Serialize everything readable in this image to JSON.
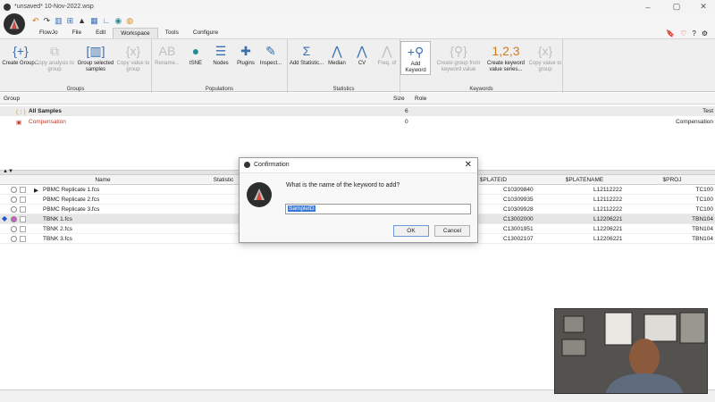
{
  "window": {
    "title": "*unsaved* 10-Nov-2022.wsp"
  },
  "menu": [
    "FlowJo",
    "File",
    "Edit",
    "Workspace",
    "Tools",
    "Configure"
  ],
  "menu_active": "Workspace",
  "ribbon": {
    "groups": {
      "groups_label": "Groups",
      "create_group": "Create Group...",
      "copy_analysis": "Copy analysis to group",
      "group_selected": "Group selected samples",
      "copy_value_group": "Copy value to group",
      "populations_label": "Populations",
      "rename": "Rename...",
      "tsne": "tSNE",
      "nodes": "Nodes",
      "plugins": "Plugins",
      "inspect": "Inspect...",
      "statistics_label": "Statistics",
      "add_statistic": "Add Statistic...",
      "median": "Median",
      "cv": "CV",
      "freq_of": "Freq. of",
      "keywords_label": "Keywords",
      "add_keyword": "Add Keyword",
      "create_group_kw": "Create group from keyword value",
      "create_kw_series": "Create keyword value series...",
      "copy_value_kw": "Copy value to group"
    }
  },
  "group_pane": {
    "headers": {
      "group": "Group",
      "size": "Size",
      "role": "Role"
    },
    "rows": [
      {
        "name": "All Samples",
        "size": "6",
        "role": "Test"
      },
      {
        "name": "Compensation",
        "size": "0",
        "role": "Compensation"
      }
    ]
  },
  "sample_pane": {
    "headers": {
      "name": "Name",
      "statistic": "Statistic",
      "plateid": "$PLATEID",
      "platename": "$PLATENAME",
      "proj": "$PROJ"
    },
    "rows": [
      {
        "name": "PBMC Replicate 1.fcs",
        "plateid": "C10309840",
        "platename": "L12112222",
        "proj": "TC100"
      },
      {
        "name": "PBMC Replicate 2.fcs",
        "plateid": "C10309935",
        "platename": "L12112222",
        "proj": "TC100"
      },
      {
        "name": "PBMC Replicate 3.fcs",
        "plateid": "C10309928",
        "platename": "L12112222",
        "proj": "TC100"
      },
      {
        "name": "TBNK 1.fcs",
        "plateid": "C13002000",
        "platename": "L12206221",
        "proj": "TBN104"
      },
      {
        "name": "TBNK 2.fcs",
        "plateid": "C13001951",
        "platename": "L12206221",
        "proj": "TBN104"
      },
      {
        "name": "TBNK 3.fcs",
        "plateid": "C13002107",
        "platename": "L12206221",
        "proj": "TBN104"
      }
    ]
  },
  "dialog": {
    "title": "Confirmation",
    "question": "What is the name of the keyword to add?",
    "input_value": "SampleID",
    "ok": "OK",
    "cancel": "Cancel"
  },
  "colors": {
    "accent": "#3a78d4",
    "compensation": "#c0392b",
    "selected_marker": "#2255cc",
    "dialog_logo": "#2d2d2d"
  }
}
